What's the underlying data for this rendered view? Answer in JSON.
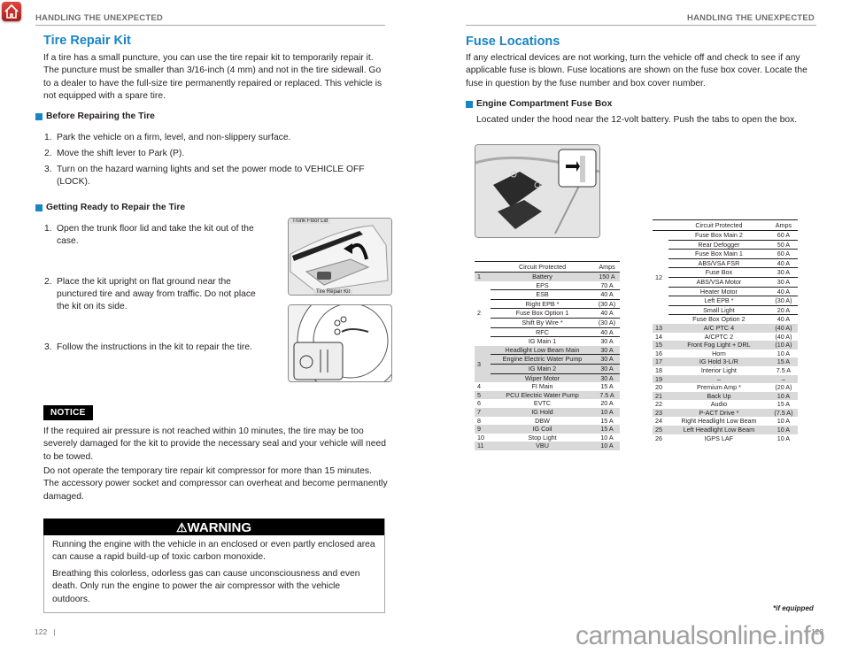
{
  "left_page": {
    "header": "HANDLING THE UNEXPECTED",
    "title": "Tire Repair Kit",
    "intro": "If a tire has a small puncture, you can use the tire repair kit to temporarily repair it. The puncture must be smaller than 3/16-inch (4 mm) and not in the tire sidewall. Go to a dealer to have the full-size tire permanently repaired or replaced. This vehicle is not equipped with a spare tire.",
    "before": {
      "heading": "Before Repairing the Tire",
      "steps": [
        {
          "n": "1.",
          "text": "Park the vehicle on a firm, level, and non-slippery surface."
        },
        {
          "n": "2.",
          "text": "Move the shift lever to Park (P)."
        },
        {
          "n": "3.",
          "text": "Turn on the hazard warning lights and set the power mode to VEHICLE OFF (LOCK)."
        }
      ]
    },
    "ready": {
      "heading": "Getting Ready to Repair the Tire",
      "steps": [
        {
          "n": "1.",
          "text": "Open the trunk floor lid and take the kit out of the case."
        },
        {
          "n": "2.",
          "text": "Place the kit upright on flat ground near the punctured tire and away from traffic. Do not place the kit on its side."
        },
        {
          "n": "3.",
          "text": "Follow the instructions in the kit to repair the tire."
        }
      ],
      "figure_labels": {
        "top": "Trunk Floor Lid",
        "bottom": "Tire Repair Kit"
      }
    },
    "notice": {
      "label": "NOTICE",
      "p1": "If the required air pressure is not reached within 10 minutes, the tire may be too severely damaged for the kit to provide the necessary seal and your vehicle will need to be towed.",
      "p2": "Do not operate the temporary tire repair kit compressor for more than 15 minutes. The accessory power socket and compressor can overheat and become permanently damaged."
    },
    "warning": {
      "icon": "⚠",
      "label": "WARNING",
      "p1": "Running the engine with the vehicle in an enclosed or even partly enclosed area can cause a rapid build-up of toxic carbon monoxide.",
      "p2": "Breathing this colorless, odorless gas can cause unconsciousness and even death. Only run the engine to power the air compressor with the vehicle outdoors."
    },
    "page_number": "122"
  },
  "right_page": {
    "header": "HANDLING THE UNEXPECTED",
    "title": "Fuse Locations",
    "intro": "If any electrical devices are not working, turn the vehicle off and check to see if any applicable fuse is blown. Fuse locations are shown on the fuse box cover. Locate the fuse in question by the fuse number and box cover number.",
    "subheading": "Engine Compartment Fuse Box",
    "subtext": "Located under the hood near the 12-volt battery. Push the tabs to open the box.",
    "table_headers": {
      "circuit": "Circuit Protected",
      "amps": "Amps"
    },
    "table1": [
      {
        "num": "1",
        "circuit": "Battery",
        "amps": "150 A"
      },
      {
        "num": "2",
        "circuit": "EPS",
        "amps": "70 A"
      },
      {
        "num": "2",
        "circuit": "ESB",
        "amps": "40 A"
      },
      {
        "num": "2",
        "circuit": "Right EPB *",
        "amps": "(30 A)"
      },
      {
        "num": "2",
        "circuit": "Fuse Box Option 1",
        "amps": "40 A"
      },
      {
        "num": "2",
        "circuit": "Shift By Wire *",
        "amps": "(30 A)"
      },
      {
        "num": "2",
        "circuit": "RFC",
        "amps": "40 A"
      },
      {
        "num": "2",
        "circuit": "IG Main 1",
        "amps": "30 A"
      },
      {
        "num": "3",
        "circuit": "Headlight Low Beam Main",
        "amps": "30 A"
      },
      {
        "num": "3",
        "circuit": "Engine Electric Water Pump",
        "amps": "30 A"
      },
      {
        "num": "3",
        "circuit": "IG Main 2",
        "amps": "30 A"
      },
      {
        "num": "3",
        "circuit": "Wiper Motor",
        "amps": "30 A"
      },
      {
        "num": "4",
        "circuit": "FI Main",
        "amps": "15 A"
      },
      {
        "num": "5",
        "circuit": "PCU Electric Water Pump",
        "amps": "7.5 A"
      },
      {
        "num": "6",
        "circuit": "EVTC",
        "amps": "20 A"
      },
      {
        "num": "7",
        "circuit": "IG Hold",
        "amps": "10 A"
      },
      {
        "num": "8",
        "circuit": "DBW",
        "amps": "15 A"
      },
      {
        "num": "9",
        "circuit": "IG Coil",
        "amps": "15 A"
      },
      {
        "num": "10",
        "circuit": "Stop Light",
        "amps": "10 A"
      },
      {
        "num": "11",
        "circuit": "VBU",
        "amps": "10 A"
      }
    ],
    "table2": [
      {
        "num": "12",
        "circuit": "Fuse Box Main 2",
        "amps": "60 A"
      },
      {
        "num": "12",
        "circuit": "Rear Defogger",
        "amps": "50 A"
      },
      {
        "num": "12",
        "circuit": "Fuse Box Main 1",
        "amps": "60 A"
      },
      {
        "num": "12",
        "circuit": "ABS/VSA FSR",
        "amps": "40 A"
      },
      {
        "num": "12",
        "circuit": "Fuse Box",
        "amps": "30 A"
      },
      {
        "num": "12",
        "circuit": "ABS/VSA Motor",
        "amps": "30 A"
      },
      {
        "num": "12",
        "circuit": "Heater Motor",
        "amps": "40 A"
      },
      {
        "num": "12",
        "circuit": "Left EPB *",
        "amps": "(30 A)"
      },
      {
        "num": "12",
        "circuit": "Small Light",
        "amps": "20 A"
      },
      {
        "num": "12",
        "circuit": "Fuse Box Option 2",
        "amps": "40 A"
      },
      {
        "num": "13",
        "circuit": "A/C PTC 4",
        "amps": "(40 A)"
      },
      {
        "num": "14",
        "circuit": "A/CPTC 2",
        "amps": "(40 A)"
      },
      {
        "num": "15",
        "circuit": "Front Fog Light + DRL",
        "amps": "(10 A)"
      },
      {
        "num": "16",
        "circuit": "Horn",
        "amps": "10 A"
      },
      {
        "num": "17",
        "circuit": "IG Hold 3-L/R",
        "amps": "15 A"
      },
      {
        "num": "18",
        "circuit": "Interior Light",
        "amps": "7.5 A"
      },
      {
        "num": "19",
        "circuit": "–",
        "amps": "–"
      },
      {
        "num": "20",
        "circuit": "Premium Amp *",
        "amps": "(20 A)"
      },
      {
        "num": "21",
        "circuit": "Back Up",
        "amps": "10 A"
      },
      {
        "num": "22",
        "circuit": "Audio",
        "amps": "15 A"
      },
      {
        "num": "23",
        "circuit": "P-ACT Drive *",
        "amps": "(7.5 A)"
      },
      {
        "num": "24",
        "circuit": "Right Headlight Low Beam",
        "amps": "10 A"
      },
      {
        "num": "25",
        "circuit": "Left Headlight Low Beam",
        "amps": "10 A"
      },
      {
        "num": "26",
        "circuit": "IGPS LAF",
        "amps": "10 A"
      }
    ],
    "footnote": "*if equipped",
    "page_number": "123"
  },
  "watermark": "carmanualsonline.info"
}
